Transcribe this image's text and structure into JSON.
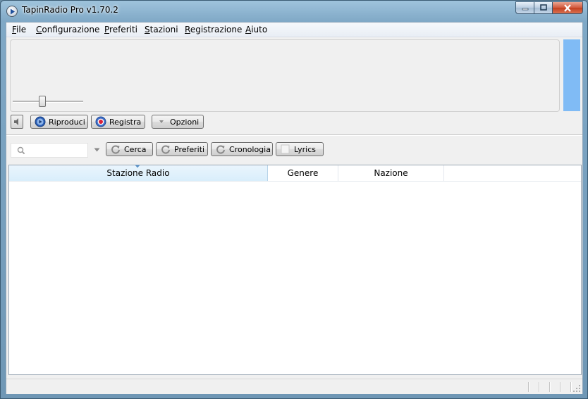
{
  "window": {
    "title": "TapinRadio Pro v1.70.2"
  },
  "menu": [
    {
      "label": "File"
    },
    {
      "label": "Configurazione"
    },
    {
      "label": "Preferiti"
    },
    {
      "label": "Stazioni"
    },
    {
      "label": "Registrazione"
    },
    {
      "label": "Aiuto"
    }
  ],
  "player": {
    "volume_level": 0.42,
    "play_label": "Riproduci",
    "record_label": "Registra",
    "options_label": "Opzioni"
  },
  "search": {
    "value": "",
    "placeholder": "",
    "buttons": {
      "search": "Cerca",
      "favorites": "Preferiti",
      "history": "Cronologia",
      "lyrics": "Lyrics"
    }
  },
  "table": {
    "columns": [
      "Stazione Radio",
      "Genere",
      "Nazione",
      ""
    ],
    "sorted_column": "Stazione Radio",
    "rows": []
  },
  "icons": {
    "app": "play-icon",
    "volume": "speaker-icon",
    "play": "play-circle-icon",
    "record": "record-icon",
    "options": "chevron-down-icon",
    "search": "magnifier-icon",
    "reset": "refresh-icon"
  },
  "colors": {
    "level_meter": "#80bbf5",
    "record_red": "#d8203a",
    "play_blue": "#2a5fb8",
    "sorted_header": "#d9eefb"
  }
}
